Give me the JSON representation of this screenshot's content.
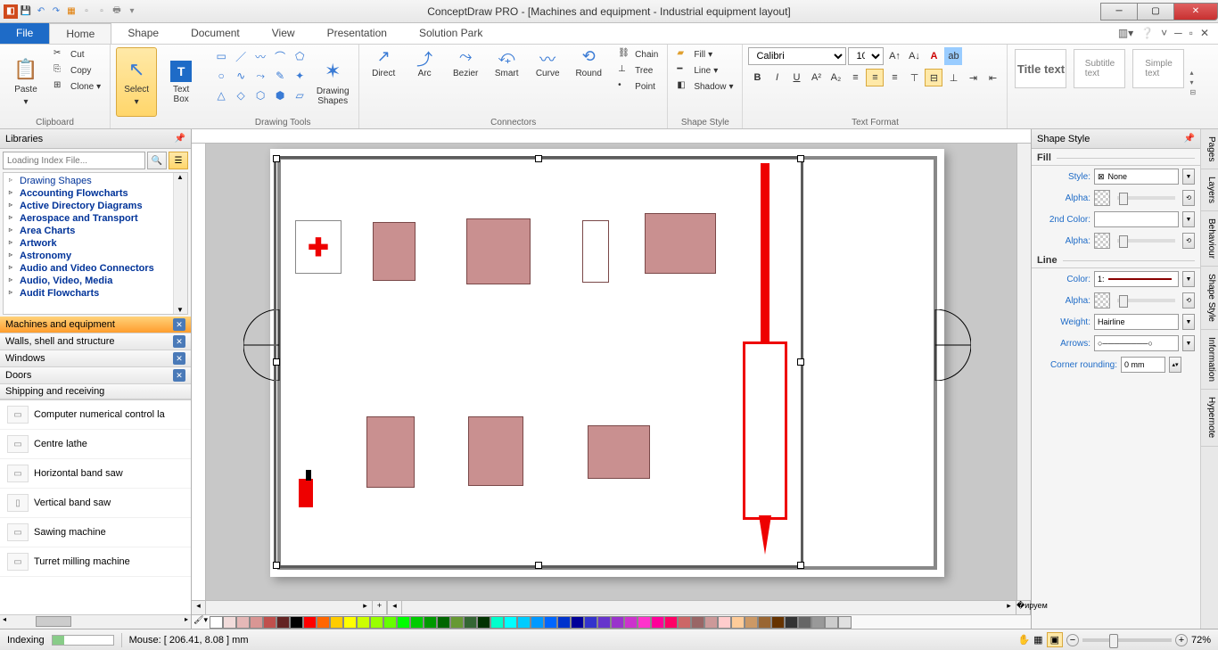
{
  "app_title": "ConceptDraw PRO - [Machines and equipment - Industrial equipment layout]",
  "menu": {
    "file": "File",
    "tabs": [
      "Home",
      "Shape",
      "Document",
      "View",
      "Presentation",
      "Solution Park"
    ],
    "active": "Home"
  },
  "ribbon": {
    "clipboard": {
      "label": "Clipboard",
      "paste": "Paste",
      "cut": "Cut",
      "copy": "Copy",
      "clone": "Clone"
    },
    "select": "Select",
    "textbox": "Text\nBox",
    "drawingtools": {
      "label": "Drawing Tools",
      "shapes": "Drawing\nShapes"
    },
    "connectors": {
      "label": "Connectors",
      "items": [
        "Direct",
        "Arc",
        "Bezier",
        "Smart",
        "Curve",
        "Round"
      ],
      "chain": "Chain",
      "tree": "Tree",
      "point": "Point"
    },
    "shapestyle": {
      "label": "Shape Style",
      "fill": "Fill",
      "line": "Line",
      "shadow": "Shadow"
    },
    "textformat": {
      "label": "Text Format",
      "font": "Calibri",
      "size": "10"
    },
    "styles": {
      "title": "Title\ntext",
      "subtitle": "Subtitle\ntext",
      "simple": "Simple\ntext"
    }
  },
  "libraries": {
    "header": "Libraries",
    "search_placeholder": "Loading Index File...",
    "tree": [
      "Drawing Shapes",
      "Accounting Flowcharts",
      "Active Directory Diagrams",
      "Aerospace and Transport",
      "Area Charts",
      "Artwork",
      "Astronomy",
      "Audio and Video Connectors",
      "Audio, Video, Media",
      "Audit Flowcharts"
    ],
    "tabs": [
      {
        "label": "Machines and equipment",
        "closable": true,
        "selected": true
      },
      {
        "label": "Walls, shell and structure",
        "closable": true
      },
      {
        "label": "Windows",
        "closable": true
      },
      {
        "label": "Doors",
        "closable": true
      },
      {
        "label": "Shipping and receiving",
        "closable": false
      }
    ],
    "shapes": [
      "Computer numerical control la",
      "Centre lathe",
      "Horizontal band saw",
      "Vertical band saw",
      "Sawing machine",
      "Turret milling machine"
    ]
  },
  "rightpanel": {
    "header": "Shape Style",
    "fill_label": "Fill",
    "line_label": "Line",
    "style": "Style:",
    "style_val": "None",
    "alpha": "Alpha:",
    "color2": "2nd Color:",
    "color": "Color:",
    "color_val": "1:",
    "weight": "Weight:",
    "weight_val": "Hairline",
    "arrows": "Arrows:",
    "corner": "Corner rounding:",
    "corner_val": "0 mm",
    "sidetabs": [
      "Pages",
      "Layers",
      "Behaviour",
      "Shape Style",
      "Information",
      "Hypernote"
    ]
  },
  "status": {
    "indexing": "Indexing",
    "mouse": "Mouse: [ 206.41, 8.08 ] mm",
    "zoom": "72%"
  },
  "colors": [
    "#ffffff",
    "#f2dcdb",
    "#e5b8b7",
    "#d99694",
    "#c0504d",
    "#632423",
    "#000000",
    "#ff0000",
    "#ff6600",
    "#ffcc00",
    "#ffff00",
    "#ccff00",
    "#99ff00",
    "#66ff00",
    "#00ff00",
    "#00cc00",
    "#009900",
    "#006600",
    "#669933",
    "#336633",
    "#003300",
    "#00ffcc",
    "#00ffff",
    "#00ccff",
    "#0099ff",
    "#0066ff",
    "#0033cc",
    "#000099",
    "#3333cc",
    "#6633cc",
    "#9933cc",
    "#cc33cc",
    "#ff33cc",
    "#ff0099",
    "#ff0066",
    "#cc6666",
    "#996666",
    "#cc9999",
    "#ffcccc",
    "#ffcc99",
    "#cc9966",
    "#996633",
    "#663300",
    "#333333",
    "#666666",
    "#999999",
    "#cccccc",
    "#e0e0e0"
  ]
}
